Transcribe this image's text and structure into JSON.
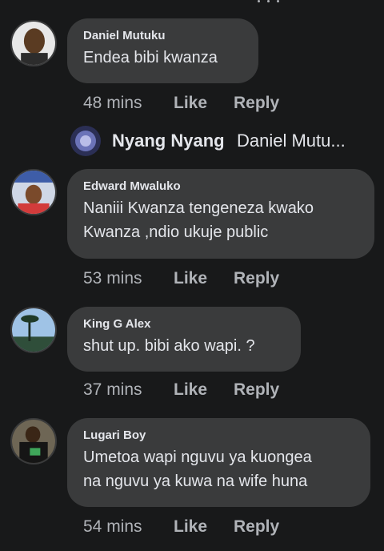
{
  "comments": [
    {
      "author": "Daniel Mutuku",
      "lines": [
        "Endea bibi kwanza"
      ],
      "time": "48 mins",
      "like": "Like",
      "reply": "Reply",
      "avatar_icon": "profile-photo-icon"
    },
    {
      "author": "Edward Mwaluko",
      "lines": [
        "Naniii Kwanza tengeneza kwako",
        "Kwanza ,ndio ukuje public"
      ],
      "time": "53 mins",
      "like": "Like",
      "reply": "Reply",
      "avatar_icon": "profile-photo-icon"
    },
    {
      "author": "King G Alex",
      "lines": [
        "shut up. bibi ako wapi. ?"
      ],
      "time": "37 mins",
      "like": "Like",
      "reply": "Reply",
      "avatar_icon": "profile-photo-icon"
    },
    {
      "author": "Lugari Boy",
      "lines": [
        "Umetoa wapi nguvu ya kuongea",
        "na nguvu ya kuwa na wife huna"
      ],
      "time": "54 mins",
      "like": "Like",
      "reply": "Reply",
      "avatar_icon": "profile-photo-icon"
    }
  ],
  "reply_preview": {
    "author": "Nyang Nyang",
    "text": "Daniel Mutu...",
    "avatar_icon": "profile-photo-icon"
  },
  "colors": {
    "background": "#18191a",
    "bubble": "#3a3b3c",
    "text": "#e4e6eb",
    "meta": "#b0b3b8"
  }
}
